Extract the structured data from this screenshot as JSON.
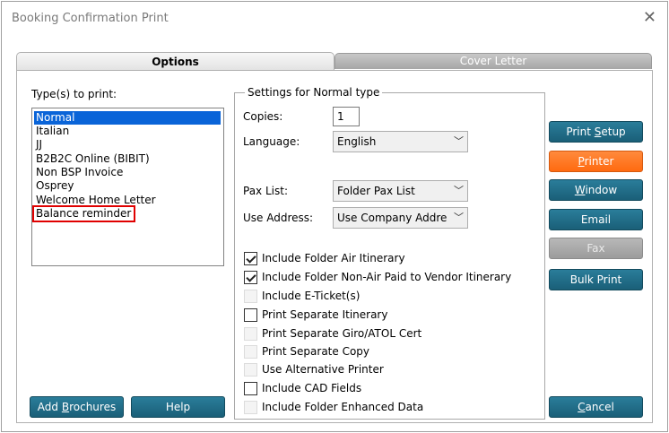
{
  "window": {
    "title": "Booking Confirmation Print"
  },
  "tabs": [
    {
      "label": "Options",
      "active": true
    },
    {
      "label": "Cover Letter",
      "active": false
    }
  ],
  "types": {
    "label": "Type(s) to print:",
    "items": [
      "Normal",
      "Italian",
      "JJ",
      "B2B2C Online (BIBIT)",
      "Non BSP Invoice",
      "Osprey",
      "Welcome Home Letter",
      "Balance reminder"
    ],
    "selected": "Normal",
    "highlighted": "Balance reminder"
  },
  "settings": {
    "title": "Settings for Normal type",
    "copies_label": "Copies:",
    "copies_value": "1",
    "language_label": "Language:",
    "language_value": "English",
    "pax_list_label": "Pax List:",
    "pax_list_value": "Folder Pax List",
    "use_address_label": "Use Address:",
    "use_address_value": "Use Company Addre",
    "checkboxes": [
      {
        "label": "Include Folder Air Itinerary",
        "checked": true,
        "enabled": true
      },
      {
        "label": "Include Folder Non-Air Paid to Vendor Itinerary",
        "checked": true,
        "enabled": true
      },
      {
        "label": "Include E-Ticket(s)",
        "checked": false,
        "enabled": false
      },
      {
        "label": "Print Separate Itinerary",
        "checked": false,
        "enabled": true
      },
      {
        "label": "Print Separate Giro/ATOL Cert",
        "checked": false,
        "enabled": false
      },
      {
        "label": "Print Separate Copy",
        "checked": false,
        "enabled": false
      },
      {
        "label": "Use Alternative Printer",
        "checked": false,
        "enabled": false
      },
      {
        "label": "Include CAD Fields",
        "checked": false,
        "enabled": true
      },
      {
        "label": "Include Folder Enhanced Data",
        "checked": false,
        "enabled": false
      }
    ]
  },
  "buttons": {
    "print_setup_pre": "Print ",
    "print_setup_ul": "S",
    "print_setup_post": "etup",
    "printer_pre": "",
    "printer_ul": "P",
    "printer_post": "rinter",
    "window_pre": "",
    "window_ul": "W",
    "window_post": "indow",
    "email": "Email",
    "fax": "Fax",
    "bulk_print": "Bulk Print",
    "add_brochures_pre": "Add ",
    "add_brochures_ul": "B",
    "add_brochures_post": "rochures",
    "help": "Help",
    "cancel_pre": "",
    "cancel_ul": "C",
    "cancel_post": "ancel"
  },
  "colors": {
    "button_teal": "#1f6b85",
    "button_orange": "#ff7a22",
    "selection_blue": "#0a64d8",
    "highlight_red": "#e00000"
  }
}
